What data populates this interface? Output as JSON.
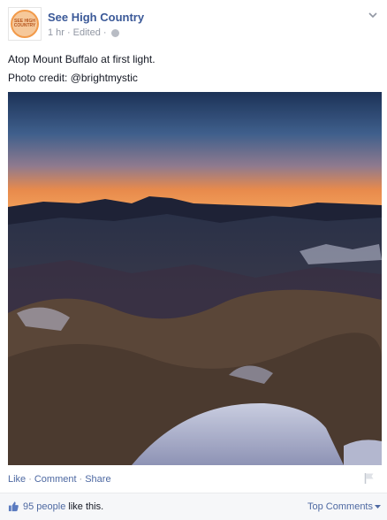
{
  "post": {
    "page_name": "See High Country",
    "time": "1 hr",
    "edited": "Edited",
    "text_line1": "Atop Mount Buffalo at first light.",
    "text_line2": "Photo credit: @brightmystic",
    "avatar_text": "SEE HIGH COUNTRY",
    "photo_icon": "landscape-photo"
  },
  "actions": {
    "like": "Like",
    "comment": "Comment",
    "share": "Share"
  },
  "likes": {
    "count": "95 people",
    "suffix": "like this."
  },
  "comments": {
    "sort_label": "Top Comments"
  },
  "colors": {
    "link": "#3b5998",
    "muted": "#9197a3",
    "bar_bg": "#f6f7f9"
  }
}
